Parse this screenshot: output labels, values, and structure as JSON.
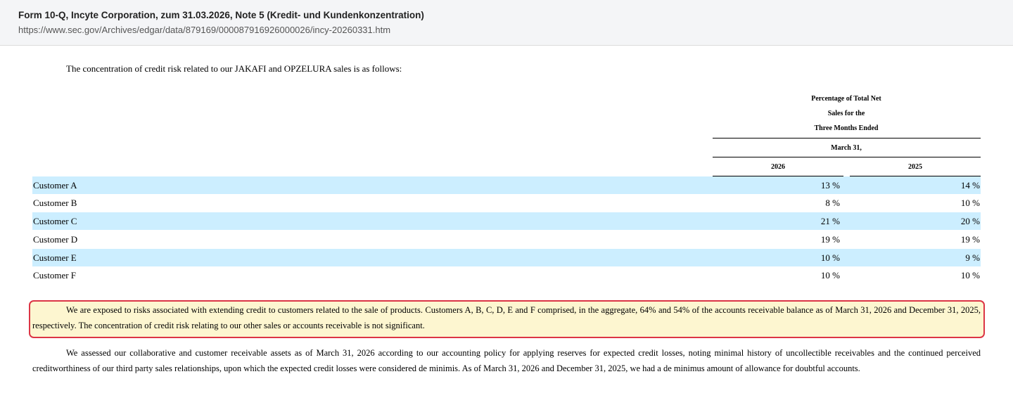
{
  "header": {
    "title": "Form 10-Q, Incyte Corporation, zum 31.03.2026, Note 5 (Kredit- und Kundenkonzentration)",
    "url": "https://www.sec.gov/Archives/edgar/data/879169/000087916926000026/incy-20260331.htm"
  },
  "document": {
    "intro": "The concentration of credit risk related to our JAKAFI and OPZELURA sales is as follows:",
    "table": {
      "header_lines": [
        "Percentage of Total Net",
        "Sales for the",
        "Three Months Ended"
      ],
      "period": "March 31,",
      "columns": [
        "2026",
        "2025"
      ],
      "rows": [
        {
          "label": "Customer A",
          "v2026": "13 %",
          "v2025": "14 %"
        },
        {
          "label": "Customer B",
          "v2026": "8 %",
          "v2025": "10 %"
        },
        {
          "label": "Customer C",
          "v2026": "21 %",
          "v2025": "20 %"
        },
        {
          "label": "Customer D",
          "v2026": "19 %",
          "v2025": "19 %"
        },
        {
          "label": "Customer E",
          "v2026": "10 %",
          "v2025": "9 %"
        },
        {
          "label": "Customer F",
          "v2026": "10 %",
          "v2025": "10 %"
        }
      ]
    },
    "highlighted_paragraph": "We are exposed to risks associated with extending credit to customers related to the sale of products. Customers A, B, C, D, E and F comprised, in the aggregate, 64% and 54% of the accounts receivable balance as of March 31, 2026 and December 31, 2025, respectively. The concentration of credit risk relating to our other sales or accounts receivable is not significant.",
    "last_paragraph": "We assessed our collaborative and customer receivable assets as of March 31, 2026 according to our accounting policy for applying reserves for expected credit losses, noting minimal history of uncollectible receivables and the continued perceived creditworthiness of our third party sales relationships, upon which the expected credit losses were considered de minimis. As of March 31, 2026 and December 31, 2025, we had a de minimus amount of allowance for doubtful accounts."
  },
  "colors": {
    "row_shade": "#cceeff",
    "highlight_background": "#fdf6d0",
    "highlight_border": "#dc3545"
  }
}
